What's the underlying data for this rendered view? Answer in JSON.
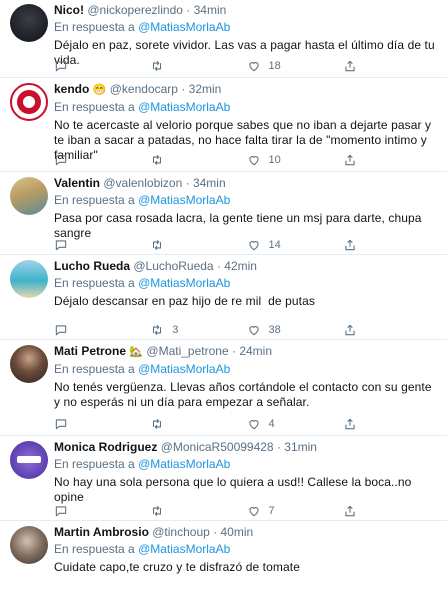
{
  "reply_prefix": "En respuesta a",
  "colors": {
    "text": "#0f1419",
    "secondary": "#5b7083",
    "link": "#1b95e0",
    "divider": "#e6ecf0"
  },
  "tweets": [
    {
      "name": "Nico!",
      "handle": "@nickoperezlindo",
      "time": "34min",
      "mention": "@MatiasMorlaAb",
      "text": "Déjalo en paz, sorete vividor. Las vas a pagar hasta el último día de tu vida.",
      "replies": "",
      "retweets": "",
      "likes": "18"
    },
    {
      "name": "kendo",
      "emoji": "😁",
      "handle": "@kendocarp",
      "time": "32min",
      "mention": "@MatiasMorlaAb",
      "text": "No te acercaste al velorio porque sabes que no iban a dejarte pasar y te iban a sacar a patadas, no hace falta tirar la de \"momento intimo y familiar\"",
      "replies": "",
      "retweets": "",
      "likes": "10"
    },
    {
      "name": "Valentin",
      "handle": "@valenlobizon",
      "time": "34min",
      "mention": "@MatiasMorlaAb",
      "text": "Pasa por casa rosada lacra, la gente tiene un msj para darte, chupa sangre",
      "replies": "",
      "retweets": "",
      "likes": "14"
    },
    {
      "name": "Lucho Rueda",
      "handle": "@LuchoRueda",
      "time": "42min",
      "mention": "@MatiasMorlaAb",
      "text": "Déjalo descansar en paz hijo de re mil  de putas",
      "replies": "",
      "retweets": "3",
      "likes": "38"
    },
    {
      "name": "Mati Petrone",
      "emoji": "🏡",
      "handle": "@Mati_petrone",
      "time": "24min",
      "mention": "@MatiasMorlaAb",
      "text": "No tenés vergüenza. Llevas años cortándole el contacto con su gente y no esperás ni un día para empezar a señalar.",
      "replies": "",
      "retweets": "",
      "likes": "4"
    },
    {
      "name": "Monica Rodriguez",
      "handle": "@MonicaR50099428",
      "time": "31min",
      "mention": "@MatiasMorlaAb",
      "text": "No hay una sola persona que lo quiera a usd!! Callese la boca..no opine",
      "replies": "",
      "retweets": "",
      "likes": "7"
    },
    {
      "name": "Martin Ambrosio",
      "handle": "@tinchoup",
      "time": "40min",
      "mention": "@MatiasMorlaAb",
      "text": "Cuidate capo,te cruzo y te disfrazó de tomate",
      "replies": "",
      "retweets": "",
      "likes": ""
    }
  ],
  "avatars": [
    "photo-dark",
    "club-crest",
    "photo-blonde",
    "photo-beach",
    "photo-dark-hair",
    "purple-badge",
    "photo-man"
  ]
}
